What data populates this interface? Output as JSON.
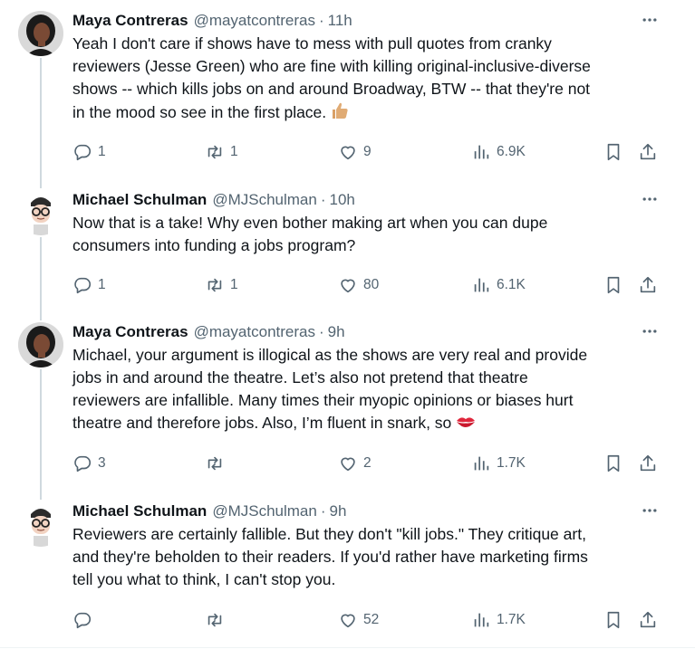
{
  "tweets": [
    {
      "name": "Maya Contreras",
      "handle": "@mayatcontreras",
      "time": "11h",
      "lines": [
        "Yeah I don't care if shows have to mess with pull quotes from cranky",
        "reviewers (Jesse Green) who are fine with killing original-inclusive-diverse",
        "shows  -- which kills jobs on and around Broadway, BTW -- that they're not",
        "in the mood so see in the first place."
      ],
      "emoji": "thumbs-up",
      "replies": "1",
      "retweets": "1",
      "likes": "9",
      "views": "6.9K"
    },
    {
      "name": "Michael Schulman",
      "handle": "@MJSchulman",
      "time": "10h",
      "lines": [
        "Now that is a take! Why even bother making art when you can dupe",
        "consumers into funding a jobs program?"
      ],
      "replies": "1",
      "retweets": "1",
      "likes": "80",
      "views": "6.1K"
    },
    {
      "name": "Maya Contreras",
      "handle": "@mayatcontreras",
      "time": "9h",
      "lines": [
        "Michael, your argument is illogical as the shows are very real and provide",
        "jobs in and around the theatre.  Let’s also not pretend that theatre",
        "reviewers are infallible. Many times their myopic opinions or biases hurt",
        "theatre and therefore jobs. Also, I’m fluent in snark, so"
      ],
      "emoji": "kiss-mark",
      "replies": "3",
      "retweets": "",
      "likes": "2",
      "views": "1.7K"
    },
    {
      "name": "Michael Schulman",
      "handle": "@MJSchulman",
      "time": "9h",
      "lines": [
        "Reviewers are certainly fallible. But they don't \"kill jobs.\" They critique art,",
        "and they're beholden to their readers. If you'd rather have marketing firms",
        "tell you what to think, I can't stop you."
      ],
      "replies": "",
      "retweets": "",
      "likes": "52",
      "views": "1.7K"
    }
  ],
  "separator": "·",
  "colors": {
    "text": "#0f1419",
    "secondary": "#536471",
    "thread_line": "#cfd9de"
  },
  "icons": [
    "reply-icon",
    "retweet-icon",
    "like-icon",
    "views-icon",
    "bookmark-icon",
    "share-icon",
    "more-icon"
  ]
}
